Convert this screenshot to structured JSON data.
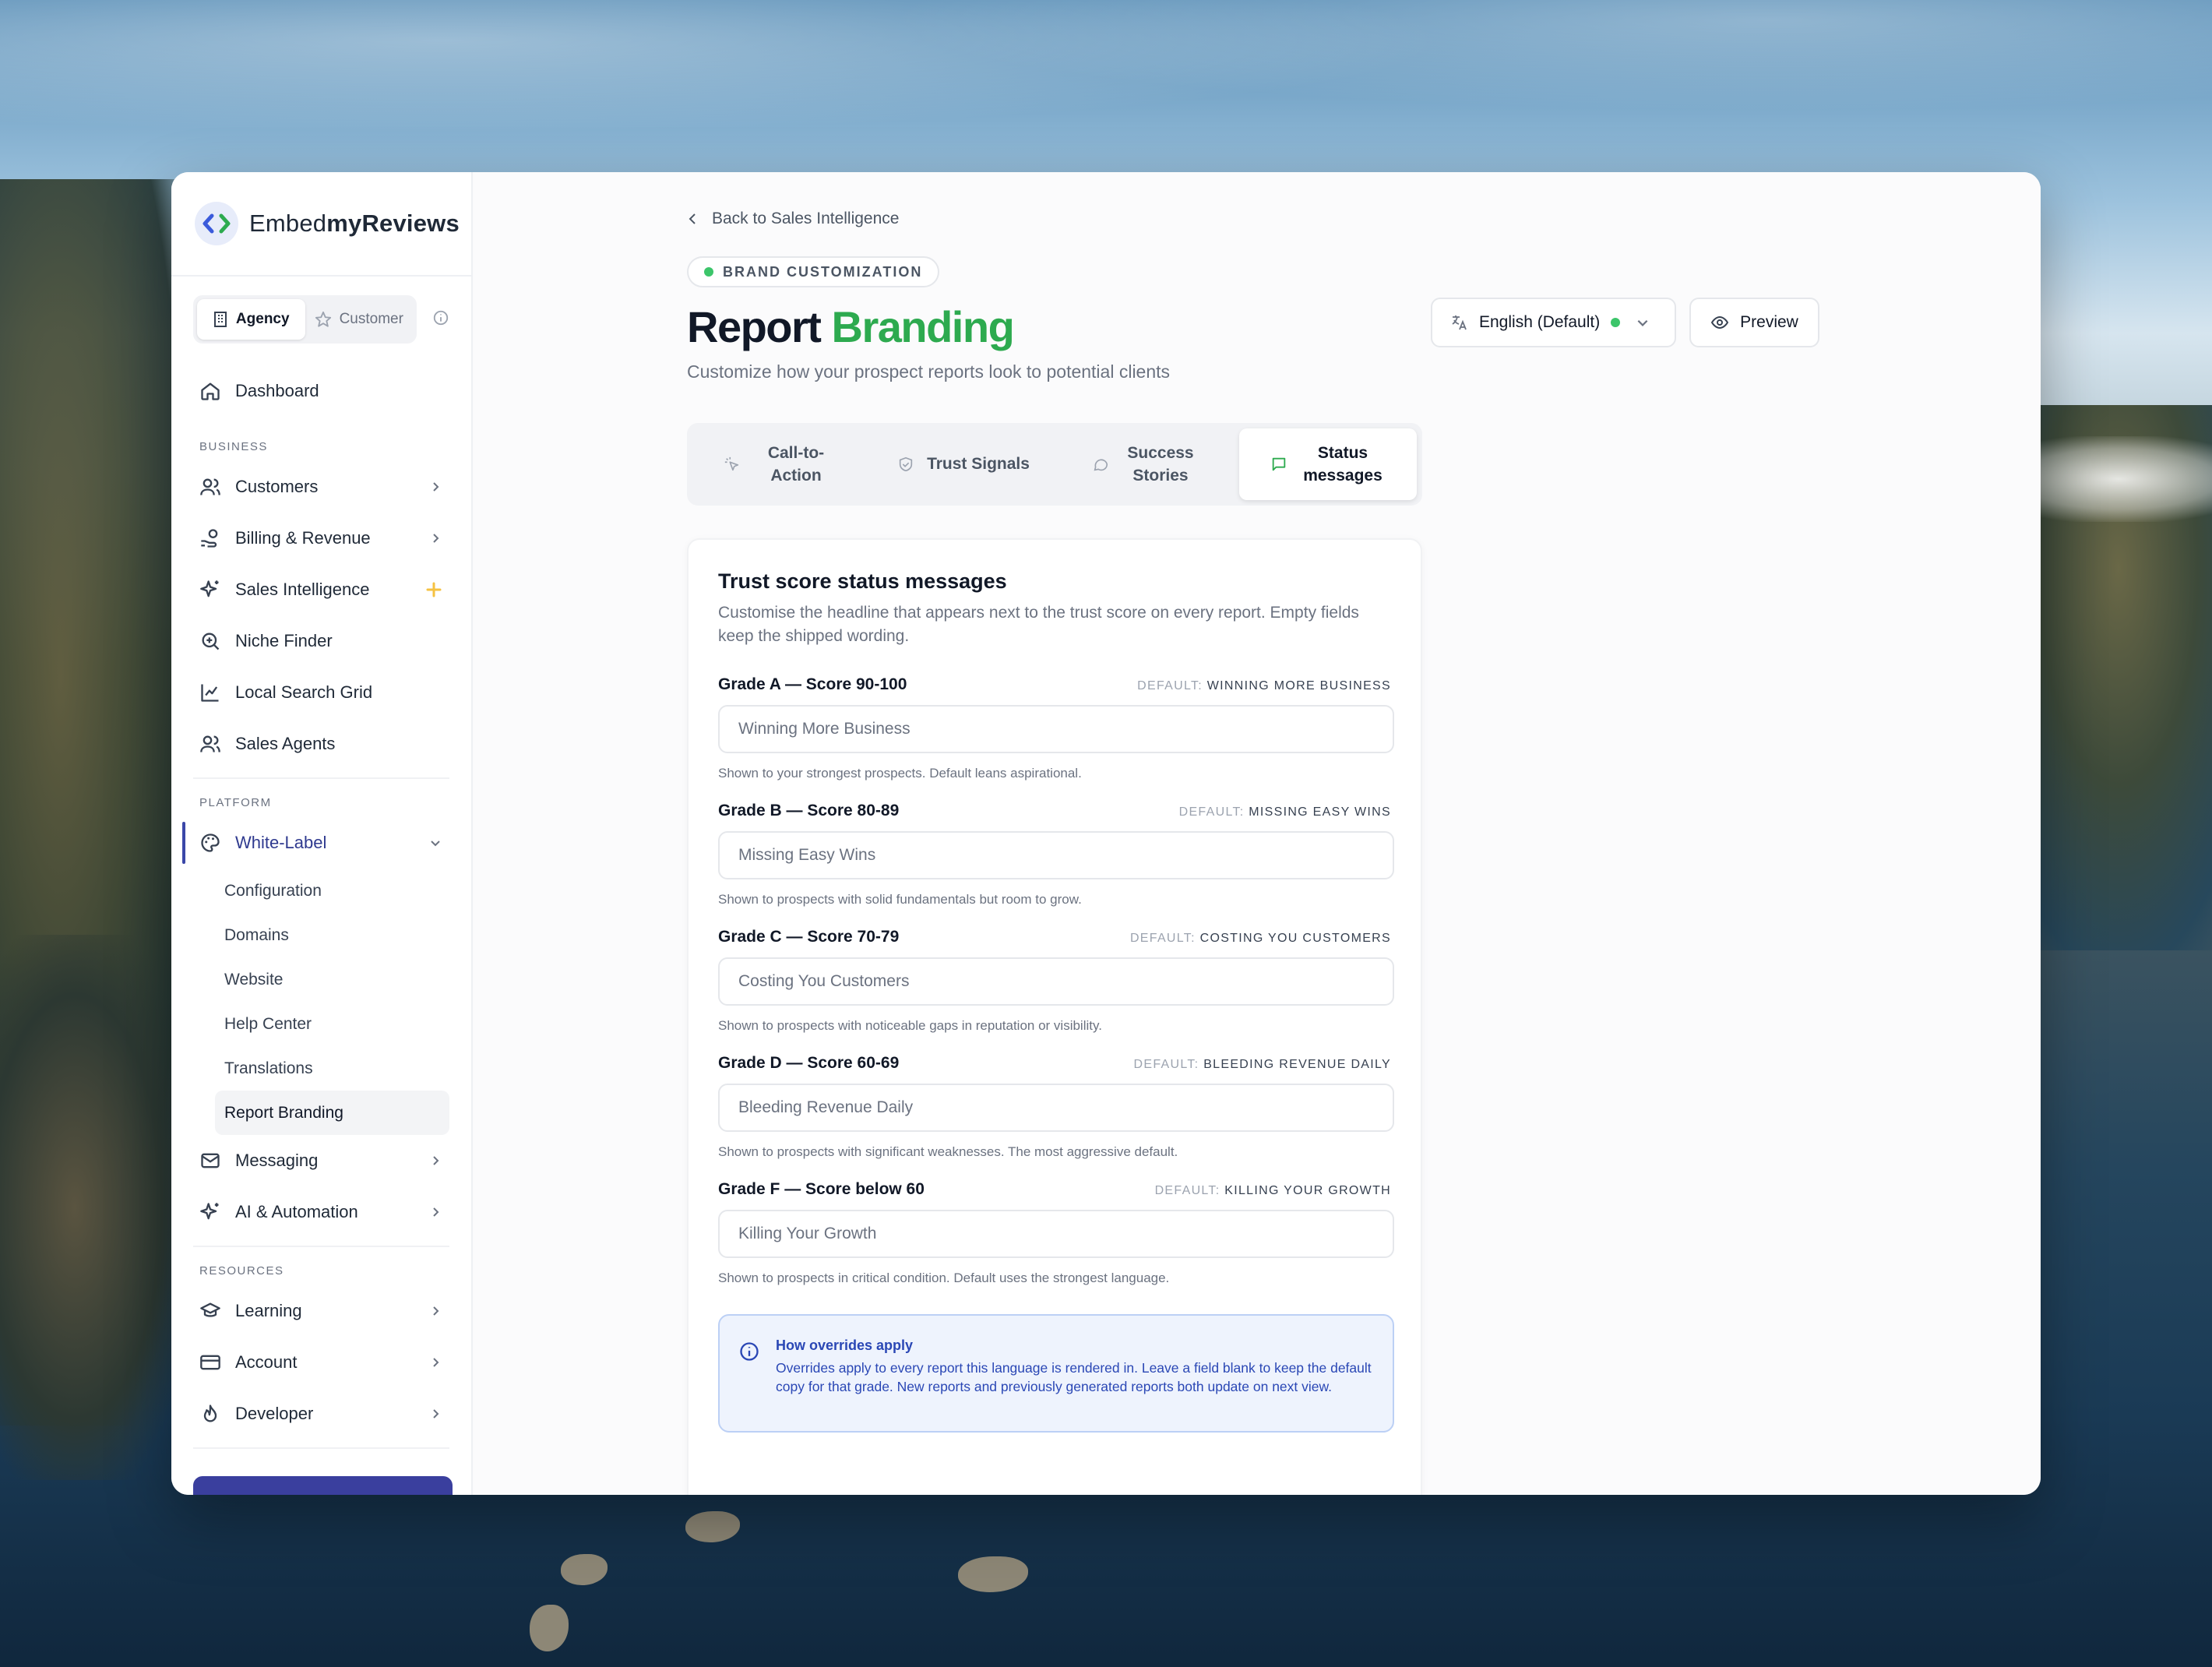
{
  "brand": {
    "name_prefix": "Embed",
    "name_bold": "myReviews"
  },
  "switcher": {
    "agency": "Agency",
    "customer": "Customer"
  },
  "nav": {
    "dashboard": "Dashboard",
    "business_label": "BUSINESS",
    "customers": "Customers",
    "billing": "Billing & Revenue",
    "sales_intelligence": "Sales Intelligence",
    "niche_finder": "Niche Finder",
    "local_search_grid": "Local Search Grid",
    "sales_agents": "Sales Agents",
    "platform_label": "PLATFORM",
    "white_label": "White-Label",
    "white_label_items": [
      "Configuration",
      "Domains",
      "Website",
      "Help Center",
      "Translations",
      "Report Branding"
    ],
    "messaging": "Messaging",
    "ai_automation": "AI & Automation",
    "resources_label": "RESOURCES",
    "learning": "Learning",
    "account": "Account",
    "developer": "Developer"
  },
  "header": {
    "back": "Back to Sales Intelligence",
    "badge": "BRAND CUSTOMIZATION",
    "title_main": "Report",
    "title_accent": "Branding",
    "subtitle": "Customize how your prospect reports look to potential clients",
    "language": "English (Default)",
    "preview": "Preview"
  },
  "tabs": {
    "cta": "Call-to-Action",
    "trust": "Trust Signals",
    "stories": "Success Stories",
    "status": "Status messages"
  },
  "card": {
    "title": "Trust score status messages",
    "description": "Customise the headline that appears next to the trust score on every report. Empty fields keep the shipped wording.",
    "default_prefix": "DEFAULT:",
    "fields": [
      {
        "label": "Grade A — Score 90-100",
        "default": "WINNING MORE BUSINESS",
        "placeholder": "Winning More Business",
        "hint": "Shown to your strongest prospects. Default leans aspirational."
      },
      {
        "label": "Grade B — Score 80-89",
        "default": "MISSING EASY WINS",
        "placeholder": "Missing Easy Wins",
        "hint": "Shown to prospects with solid fundamentals but room to grow."
      },
      {
        "label": "Grade C — Score 70-79",
        "default": "COSTING YOU CUSTOMERS",
        "placeholder": "Costing You Customers",
        "hint": "Shown to prospects with noticeable gaps in reputation or visibility."
      },
      {
        "label": "Grade D — Score 60-69",
        "default": "BLEEDING REVENUE DAILY",
        "placeholder": "Bleeding Revenue Daily",
        "hint": "Shown to prospects with significant weaknesses. The most aggressive default."
      },
      {
        "label": "Grade F — Score below 60",
        "default": "KILLING YOUR GROWTH",
        "placeholder": "Killing Your Growth",
        "hint": "Shown to prospects in critical condition. Default uses the strongest language."
      }
    ],
    "callout_title": "How overrides apply",
    "callout_text": "Overrides apply to every report this language is rendered in. Leave a field blank to keep the default copy for that grade. New reports and previously generated reports both update on next view."
  },
  "colors": {
    "accent_green": "#2daa4f",
    "nav_active": "#3b47a8",
    "info_blue": "#2a47b5"
  }
}
